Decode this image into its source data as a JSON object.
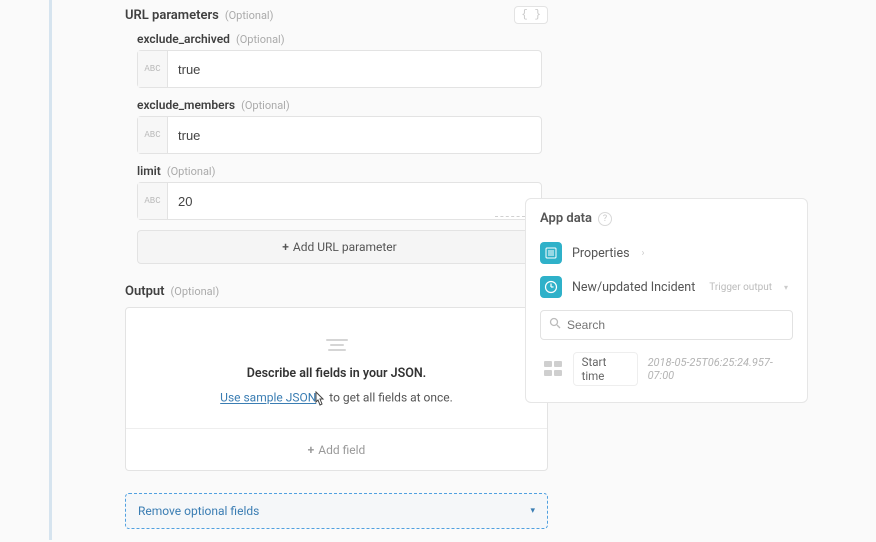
{
  "url_parameters": {
    "title": "URL parameters",
    "optional": "(Optional)",
    "code_toggle": "{ }",
    "fields": [
      {
        "name": "exclude_archived",
        "value": "true"
      },
      {
        "name": "exclude_members",
        "value": "true"
      },
      {
        "name": "limit",
        "value": "20"
      }
    ],
    "abc": "ABC",
    "add_button": "Add URL parameter"
  },
  "output": {
    "title": "Output",
    "optional": "(Optional)",
    "describe": "Describe all fields in your JSON.",
    "sample_link": "Use sample JSON",
    "sample_suffix": " to get all fields at once.",
    "add_field": "Add field"
  },
  "remove_bar": {
    "label": "Remove optional fields"
  },
  "app_data": {
    "title": "App data",
    "properties": "Properties",
    "incident": "New/updated Incident",
    "trigger_output": "Trigger output",
    "search_placeholder": "Search",
    "result_name": "Start time",
    "result_value": "2018-05-25T06:25:24.957-07:00"
  }
}
